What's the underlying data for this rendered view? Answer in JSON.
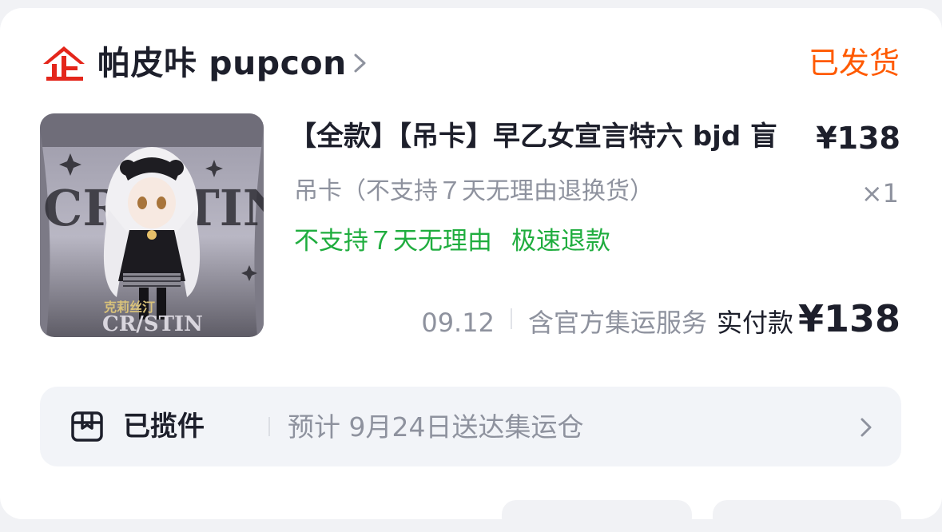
{
  "shop": {
    "name": "帕皮咔 pupcon",
    "icon": "shop-logo-icon",
    "brand_color": "#e4261b"
  },
  "order": {
    "status": "已发货",
    "status_color": "#ff5a00"
  },
  "product": {
    "title": "【全款】【吊卡】早乙女宣言特六 bjd 盲",
    "price": "¥138",
    "sku": "吊卡（不支持７天无理由退换货）",
    "quantity": "×1",
    "tags": [
      "不支持７天无理由",
      "极速退款"
    ],
    "tag_color": "#1fad3e",
    "image_text": {
      "brand_big": "CRISTIN",
      "brand_small": "克莉丝汀",
      "brand_bottom": "CRISTIN"
    }
  },
  "summary": {
    "date": "09.12",
    "service": "含官方集运服务",
    "paid_label": "实付款",
    "paid_amount": "¥138"
  },
  "logistics": {
    "icon": "package-box-icon",
    "state": "已揽件",
    "eta": "预计 9月24日送达集运仓"
  }
}
